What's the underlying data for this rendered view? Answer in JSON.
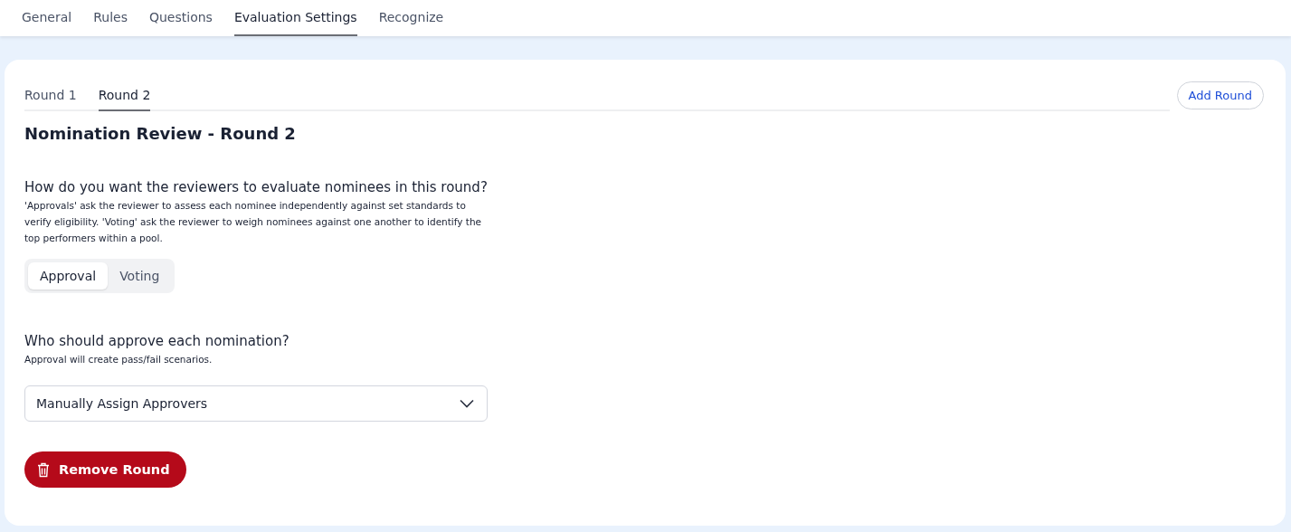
{
  "nav_tabs": [
    {
      "label": "General",
      "selected": false
    },
    {
      "label": "Rules",
      "selected": false
    },
    {
      "label": "Questions",
      "selected": false
    },
    {
      "label": "Evaluation Settings",
      "selected": true
    },
    {
      "label": "Recognize",
      "selected": false
    }
  ],
  "round_tabs": [
    {
      "label": "Round 1",
      "selected": false
    },
    {
      "label": "Round 2",
      "selected": true
    }
  ],
  "add_round_button": "Add Round",
  "heading": "Nomination Review - Round 2",
  "evaluation": {
    "question": "How do you want the reviewers to evaluate nominees in this round?",
    "help": "'Approvals' ask the reviewer to assess each nominee independently against set standards to verify eligibility. 'Voting' ask the reviewer to weigh nominees against one another to identify the top performers within a pool.",
    "options": [
      {
        "label": "Approval",
        "selected": true
      },
      {
        "label": "Voting",
        "selected": false
      }
    ]
  },
  "approvers": {
    "question": "Who should approve each nomination?",
    "help": "Approval will create pass/fail scenarios.",
    "value": "Manually Assign Approvers"
  },
  "remove_button": "Remove Round"
}
